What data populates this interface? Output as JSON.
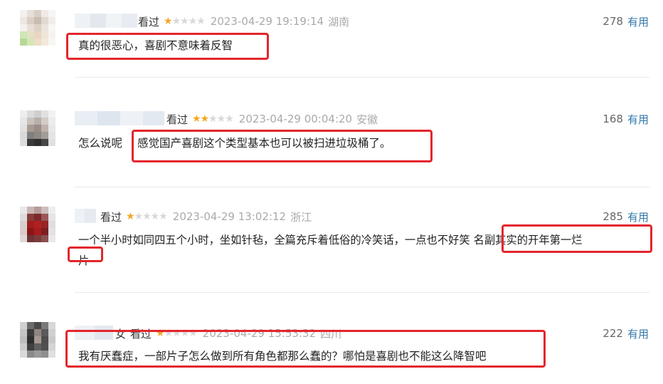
{
  "comments": [
    {
      "seen_label": "看过",
      "rating": 1,
      "time": "2023-04-29 19:19:14",
      "location": "湖南",
      "vote_count": "278",
      "useful_label": "有用",
      "text_lines": [
        "真的很恶心，喜剧不意味着反智"
      ]
    },
    {
      "seen_label": "看过",
      "rating": 2,
      "time": "2023-04-29 00:04:20",
      "location": "安徽",
      "vote_count": "168",
      "useful_label": "有用",
      "text_prefix": "怎么说呢",
      "text_lines": [
        "感觉国产喜剧这个类型基本也可以被扫进垃圾桶了。"
      ]
    },
    {
      "seen_label": "看过",
      "rating": 1,
      "time": "2023-04-29 13:02:12",
      "location": "浙江",
      "vote_count": "285",
      "useful_label": "有用",
      "text_lines": [
        "一个半小时如同四五个小时，坐如针毡，全篇充斥着低俗的冷笑话，一点也不好笑 名副其实的开年第一烂",
        "片"
      ]
    },
    {
      "user_suffix": "女",
      "seen_label": "看过",
      "rating": 1,
      "time": "2023-04-29 15:53:32",
      "location": "四川",
      "vote_count": "222",
      "useful_label": "有用",
      "text_lines": [
        "我有厌蠢症，一部片子怎么做到所有角色都那么蠢的？哪怕是喜剧也不能这么降智吧"
      ]
    }
  ],
  "colors": {
    "highlight": "#e3262c",
    "star_on": "#f5a623",
    "star_off": "#d8d8d8",
    "useful": "#3377aa"
  }
}
